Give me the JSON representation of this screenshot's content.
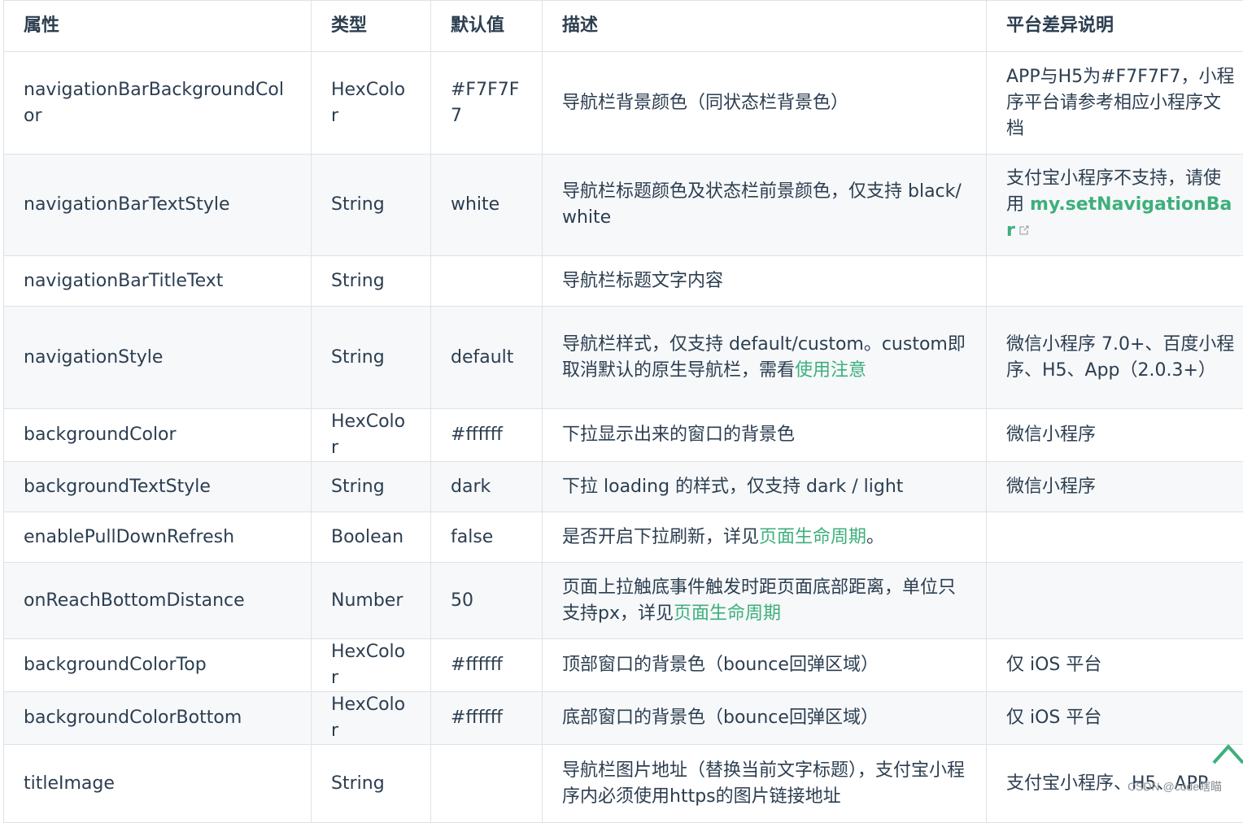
{
  "headers": [
    "属性",
    "类型",
    "默认值",
    "描述",
    "平台差异说明"
  ],
  "rows": [
    {
      "name": "navigationBarBackgroundColor",
      "type": "HexColor",
      "default": "#F7F7F7",
      "desc": "导航栏背景颜色（同状态栏背景色）",
      "platform": "APP与H5为#F7F7F7，小程序平台请参考相应小程序文档"
    },
    {
      "name": "navigationBarTextStyle",
      "type": "String",
      "default": "white",
      "desc": "导航栏标题颜色及状态栏前景颜色，仅支持 black/white",
      "platform": "支付宝小程序不支持，请使用",
      "platform_link": "my.setNavigationBar"
    },
    {
      "name": "navigationBarTitleText",
      "type": "String",
      "default": "",
      "desc": "导航栏标题文字内容",
      "platform": ""
    },
    {
      "name": "navigationStyle",
      "type": "String",
      "default": "default",
      "desc": "导航栏样式，仅支持 default/custom。custom即取消默认的原生导航栏，需看",
      "desc_link": "使用注意",
      "platform": "微信小程序 7.0+、百度小程序、H5、App（2.0.3+）"
    },
    {
      "name": "backgroundColor",
      "type": "HexColor",
      "default": "#ffffff",
      "desc": "下拉显示出来的窗口的背景色",
      "platform": "微信小程序"
    },
    {
      "name": "backgroundTextStyle",
      "type": "String",
      "default": "dark",
      "desc": "下拉 loading 的样式，仅支持 dark / light",
      "platform": "微信小程序"
    },
    {
      "name": "enablePullDownRefresh",
      "type": "Boolean",
      "default": "false",
      "desc": "是否开启下拉刷新，详见",
      "desc_link": "页面生命周期",
      "desc_after": "。",
      "platform": ""
    },
    {
      "name": "onReachBottomDistance",
      "type": "Number",
      "default": "50",
      "desc": "页面上拉触底事件触发时距页面底部距离，单位只支持px，详见",
      "desc_link": "页面生命周期",
      "platform": ""
    },
    {
      "name": "backgroundColorTop",
      "type": "HexColor",
      "default": "#ffffff",
      "desc": "顶部窗口的背景色（bounce回弹区域）",
      "platform": "仅 iOS 平台"
    },
    {
      "name": "backgroundColorBottom",
      "type": "HexColor",
      "default": "#ffffff",
      "desc": "底部窗口的背景色（bounce回弹区域）",
      "platform": "仅 iOS 平台"
    },
    {
      "name": "titleImage",
      "type": "String",
      "default": "",
      "desc": "导航栏图片地址（替换当前文字标题），支付宝小程序内必须使用https的图片链接地址",
      "platform": "支付宝小程序、H5、APP"
    }
  ],
  "watermark": "CSDN @code瞎瞄",
  "colors": {
    "link": "#3eaf7c",
    "border": "#dfe2e5",
    "stripe": "#f6f8fa",
    "text": "#2c3e50"
  }
}
